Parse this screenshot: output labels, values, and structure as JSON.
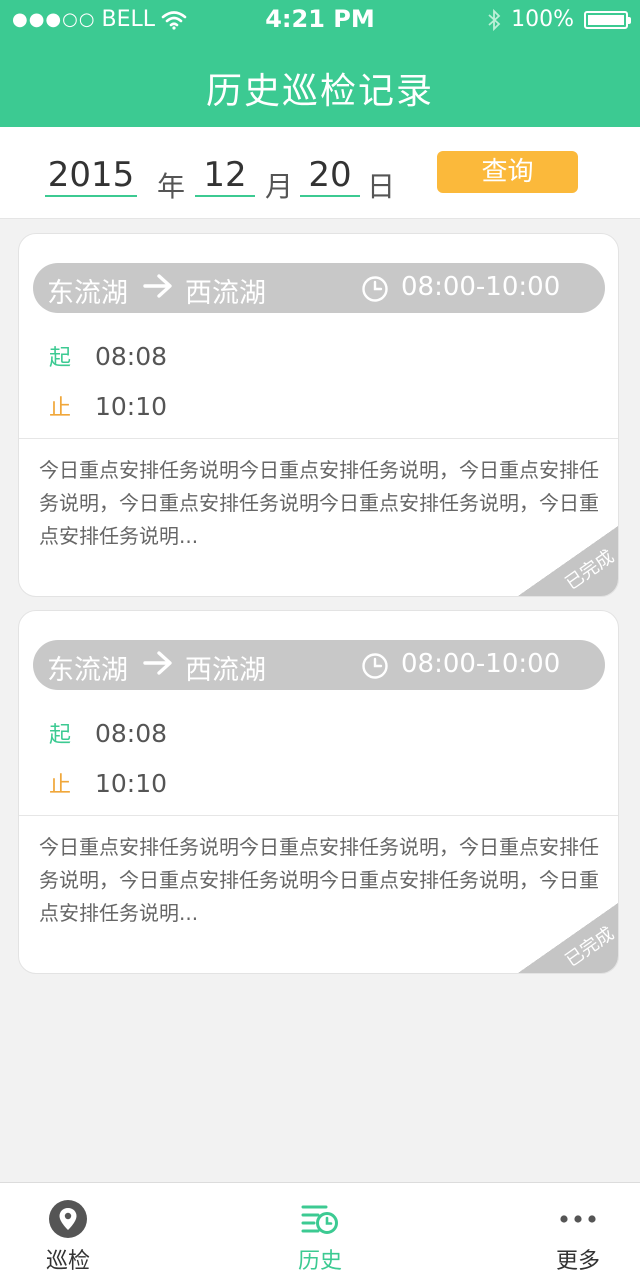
{
  "status_bar": {
    "carrier": "BELL",
    "time": "4:21 PM",
    "battery": "100%"
  },
  "header": {
    "title": "历史巡检记录"
  },
  "date_query": {
    "year": "2015",
    "year_unit": "年",
    "month": "12",
    "month_unit": "月",
    "day": "20",
    "day_unit": "日",
    "query_label": "查询"
  },
  "records": [
    {
      "from": "东流湖",
      "to": "西流湖",
      "period": "08:00-10:00",
      "start_label": "起",
      "start_time": "08:08",
      "end_label": "止",
      "end_time": "10:10",
      "description": "今日重点安排任务说明今日重点安排任务说明，今日重点安排任务说明，今日重点安排任务说明今日重点安排任务说明，今日重点安排任务说明...",
      "status": "已完成"
    },
    {
      "from": "东流湖",
      "to": "西流湖",
      "period": "08:00-10:00",
      "start_label": "起",
      "start_time": "08:08",
      "end_label": "止",
      "end_time": "10:10",
      "description": "今日重点安排任务说明今日重点安排任务说明，今日重点安排任务说明，今日重点安排任务说明今日重点安排任务说明，今日重点安排任务说明...",
      "status": "已完成"
    }
  ],
  "tabs": [
    {
      "label": "巡检",
      "icon": "location-pin-icon",
      "active": false
    },
    {
      "label": "历史",
      "icon": "history-list-icon",
      "active": true
    },
    {
      "label": "更多",
      "icon": "more-dots-icon",
      "active": false
    }
  ],
  "colors": {
    "brand": "#3cca92",
    "query_button": "#fbb93b",
    "start_label": "#3cca92",
    "end_label": "#f0a73a",
    "inactive_tab": "#333333"
  }
}
